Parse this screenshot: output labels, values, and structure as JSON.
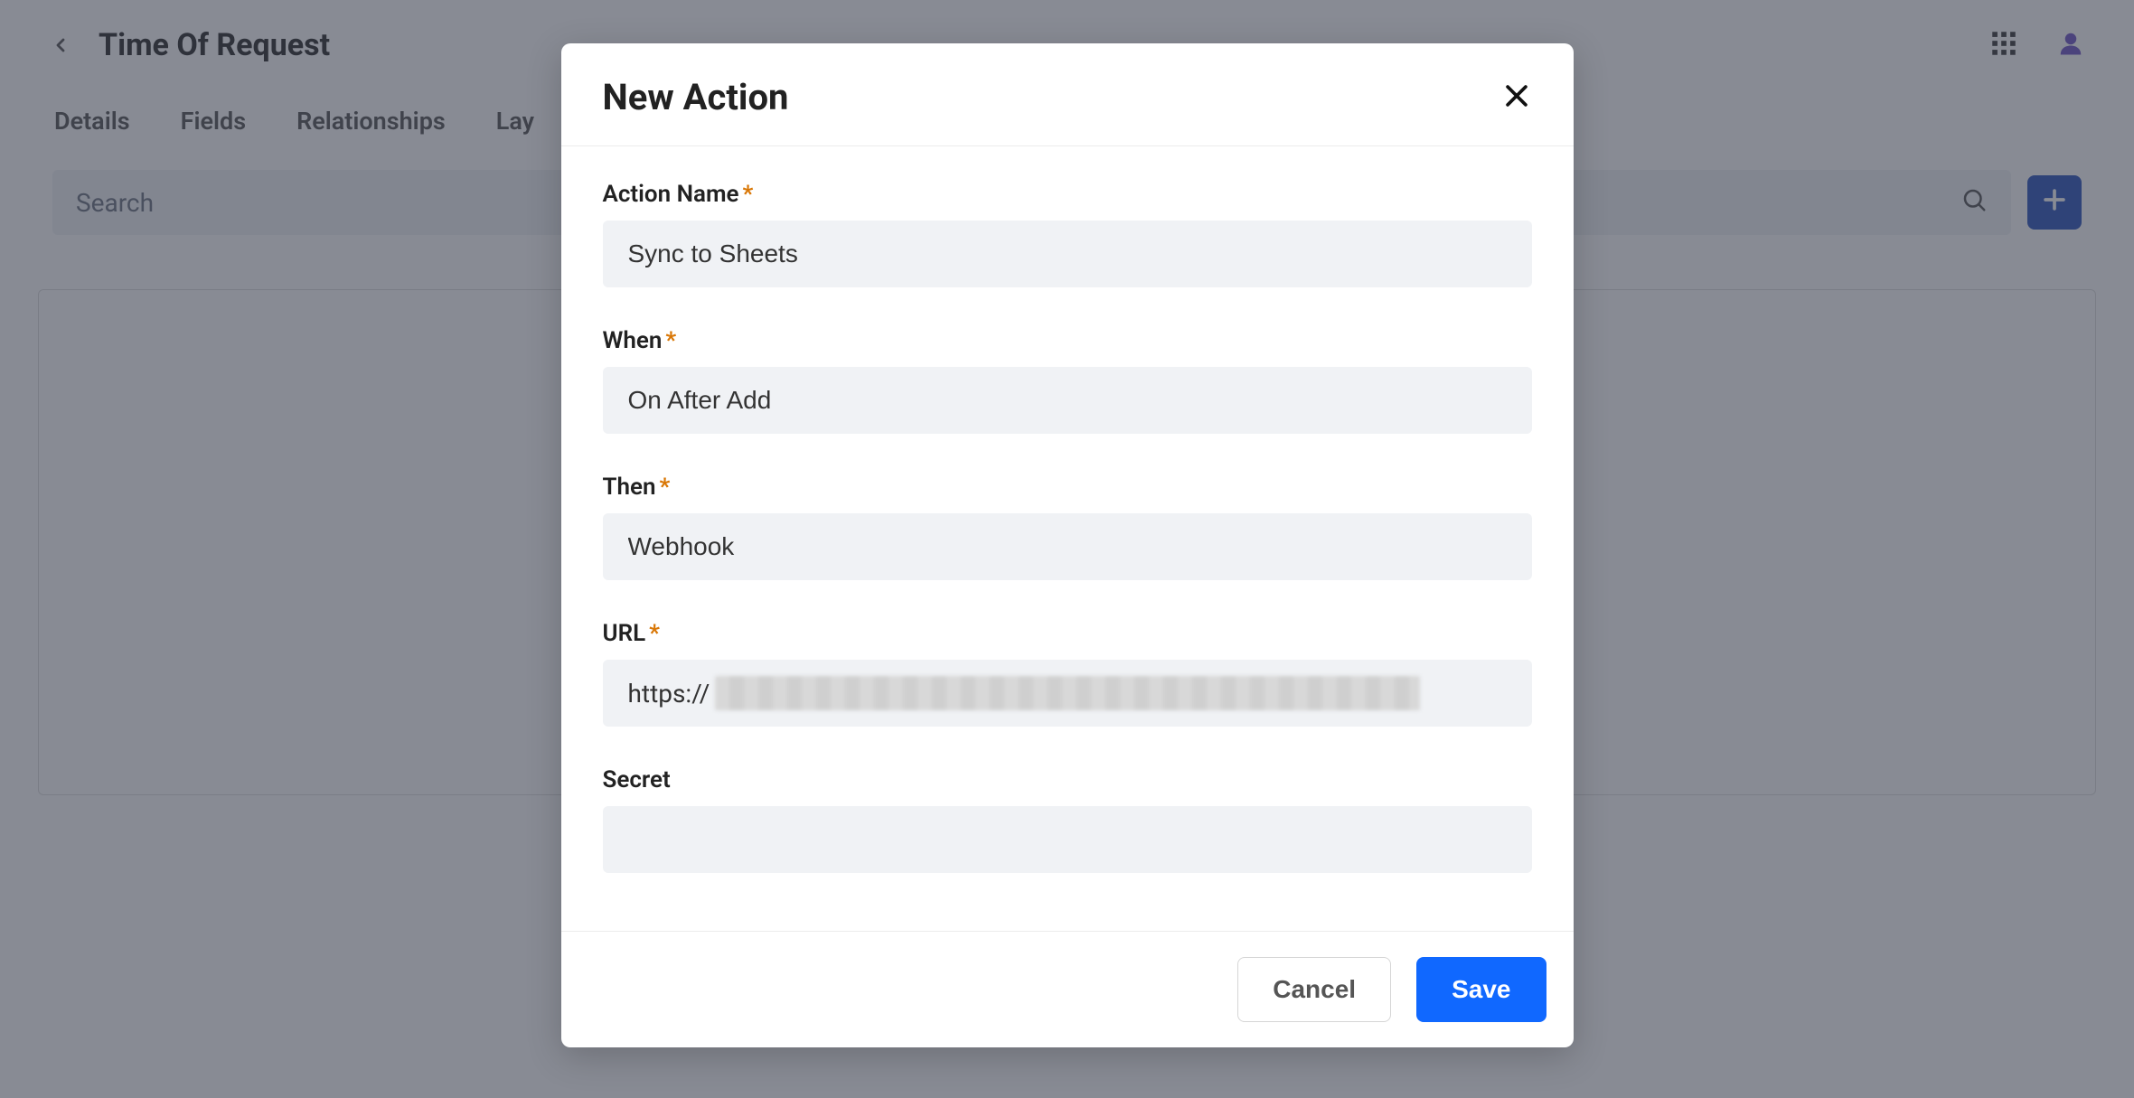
{
  "page": {
    "title": "Time Of Request",
    "tabs": [
      "Details",
      "Fields",
      "Relationships",
      "Lay"
    ],
    "search_placeholder": "Search"
  },
  "modal": {
    "title": "New Action",
    "fields": {
      "action_name": {
        "label": "Action Name",
        "value": "Sync to Sheets",
        "required": true
      },
      "when": {
        "label": "When",
        "value": "On After Add",
        "required": true
      },
      "then": {
        "label": "Then",
        "value": "Webhook",
        "required": true
      },
      "url": {
        "label": "URL",
        "prefix": "https://",
        "required": true
      },
      "secret": {
        "label": "Secret",
        "value": "",
        "required": false
      }
    },
    "buttons": {
      "cancel": "Cancel",
      "save": "Save"
    }
  }
}
